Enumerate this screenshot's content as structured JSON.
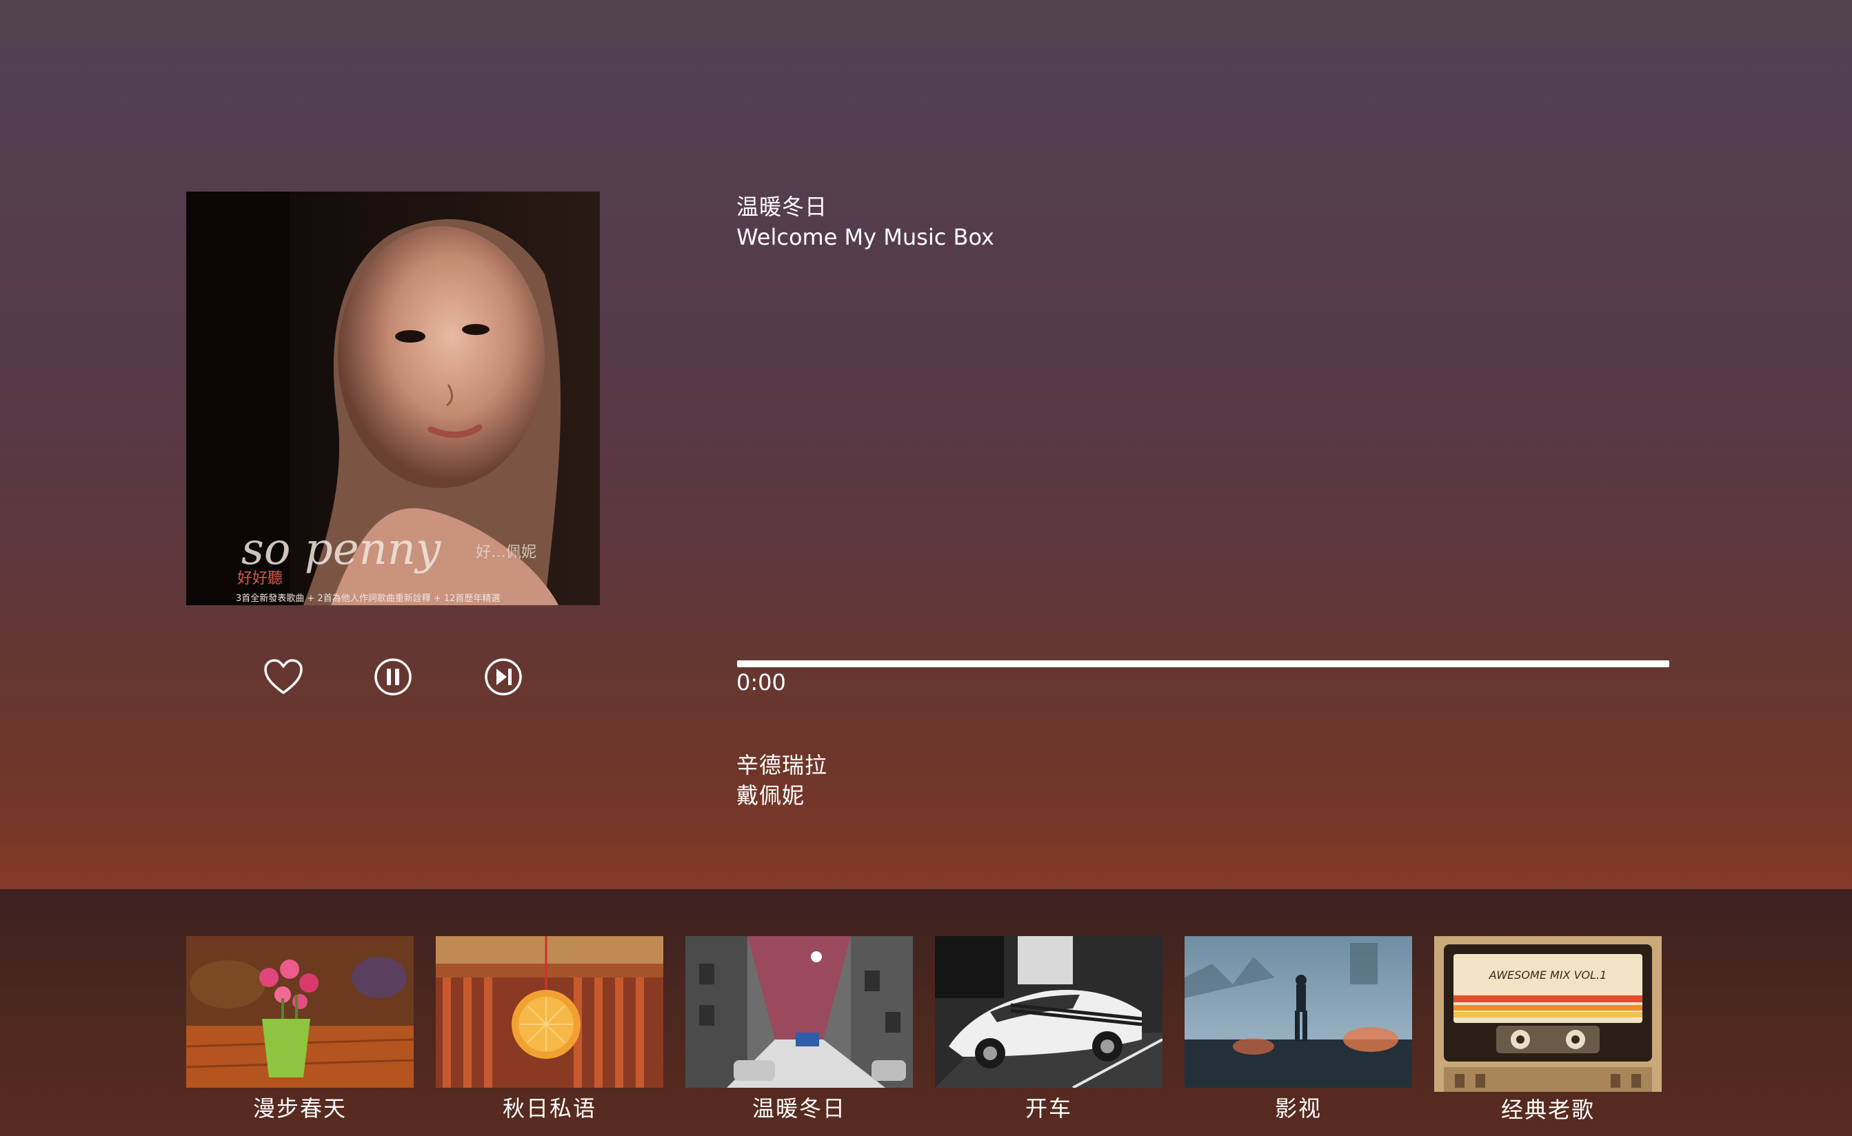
{
  "now_playing": {
    "title": "温暖冬日",
    "subtitle": "Welcome My Music Box",
    "song": "辛德瑞拉",
    "artist": "戴佩妮",
    "time_current": "0:00",
    "progress": 1.0
  },
  "cover": {
    "script_text": "so penny",
    "small_text": "好…佩妮",
    "caption": "3首全新發表歌曲 + 2首為他人作詞歌曲重新詮釋 + 12首歷年精選",
    "red_text": "好好聽"
  },
  "controls": {
    "like_icon": "heart-icon",
    "pause_icon": "pause-icon",
    "next_icon": "skip-next-icon"
  },
  "playlist": [
    {
      "label": "漫步春天"
    },
    {
      "label": "秋日私语"
    },
    {
      "label": "温暖冬日"
    },
    {
      "label": "开车"
    },
    {
      "label": "影视"
    },
    {
      "label": "经典老歌",
      "cassette_text": "AWESOME MIX VOL.1"
    }
  ],
  "colors": {
    "text": "#ffffff",
    "progress": "#ffffff"
  }
}
